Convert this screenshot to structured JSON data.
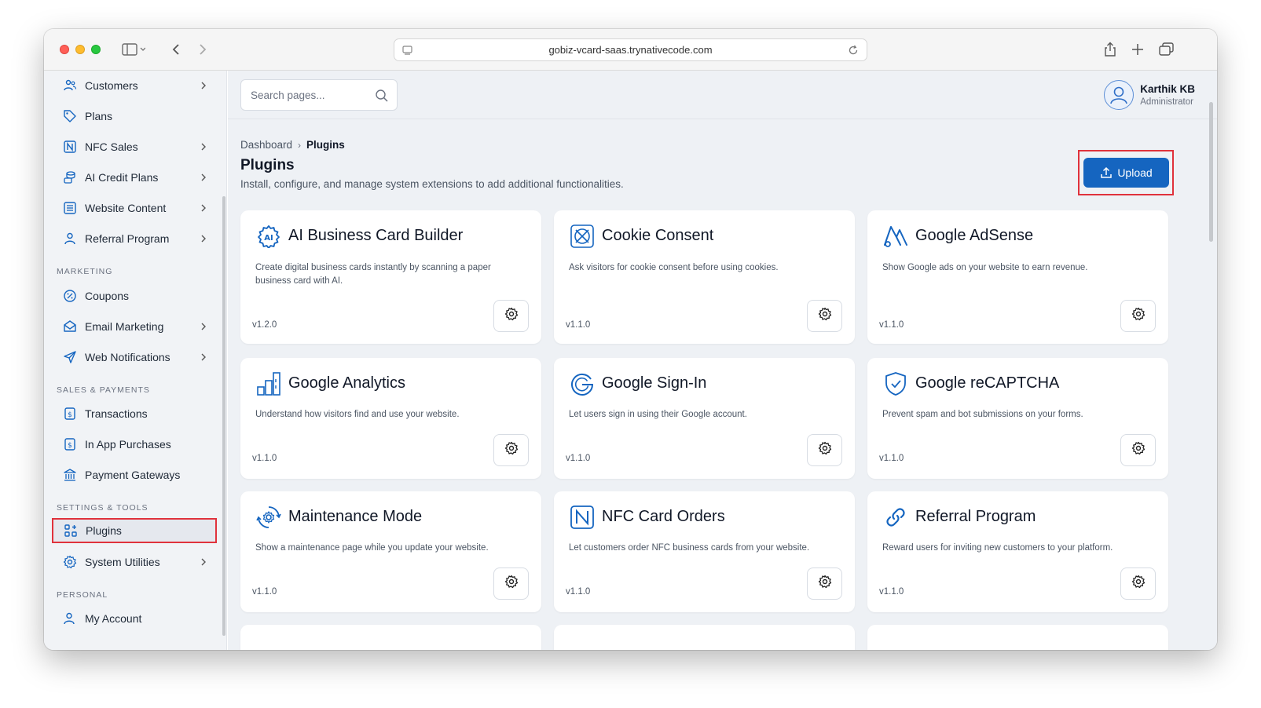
{
  "browser": {
    "url": "gobiz-vcard-saas.trynativecode.com"
  },
  "sidebar": {
    "items_top": [
      {
        "label": "Customers",
        "icon": "users-icon",
        "chevron": true
      },
      {
        "label": "Plans",
        "icon": "tag-icon",
        "chevron": false
      },
      {
        "label": "NFC Sales",
        "icon": "nfc-icon",
        "chevron": true
      },
      {
        "label": "AI Credit Plans",
        "icon": "coins-icon",
        "chevron": true
      },
      {
        "label": "Website Content",
        "icon": "document-icon",
        "chevron": true
      },
      {
        "label": "Referral Program",
        "icon": "user-icon",
        "chevron": true
      }
    ],
    "sections": {
      "marketing": "MARKETING",
      "sales": "SALES & PAYMENTS",
      "settings": "SETTINGS & TOOLS",
      "personal": "PERSONAL"
    },
    "marketing_items": [
      {
        "label": "Coupons",
        "icon": "percent-icon",
        "chevron": false
      },
      {
        "label": "Email Marketing",
        "icon": "mail-icon",
        "chevron": true
      },
      {
        "label": "Web Notifications",
        "icon": "send-icon",
        "chevron": true
      }
    ],
    "sales_items": [
      {
        "label": "Transactions",
        "icon": "receipt-icon",
        "chevron": false
      },
      {
        "label": "In App Purchases",
        "icon": "receipt-icon",
        "chevron": false
      },
      {
        "label": "Payment Gateways",
        "icon": "bank-icon",
        "chevron": false
      }
    ],
    "settings_items": [
      {
        "label": "Plugins",
        "icon": "apps-icon",
        "chevron": false,
        "active": true
      },
      {
        "label": "System Utilities",
        "icon": "gear-icon",
        "chevron": true
      }
    ],
    "personal_items": [
      {
        "label": "My Account",
        "icon": "account-icon",
        "chevron": false
      }
    ]
  },
  "header": {
    "search_placeholder": "Search pages...",
    "user_name": "Karthik KB",
    "user_role": "Administrator"
  },
  "page": {
    "breadcrumb_root": "Dashboard",
    "breadcrumb_sep": "›",
    "breadcrumb_current": "Plugins",
    "title": "Plugins",
    "description": "Install, configure, and manage system extensions to add additional functionalities.",
    "upload_label": "Upload"
  },
  "plugins": [
    {
      "title": "AI Business Card Builder",
      "desc": "Create digital business cards instantly by scanning a paper business card with AI.",
      "version": "v1.2.0",
      "icon": "ai-gear-icon"
    },
    {
      "title": "Cookie Consent",
      "desc": "Ask visitors for cookie consent before using cookies.",
      "version": "v1.1.0",
      "icon": "cookie-icon"
    },
    {
      "title": "Google AdSense",
      "desc": "Show Google ads on your website to earn revenue.",
      "version": "v1.1.0",
      "icon": "adsense-icon"
    },
    {
      "title": "Google Analytics",
      "desc": "Understand how visitors find and use your website.",
      "version": "v1.1.0",
      "icon": "analytics-icon"
    },
    {
      "title": "Google Sign-In",
      "desc": "Let users sign in using their Google account.",
      "version": "v1.1.0",
      "icon": "google-icon"
    },
    {
      "title": "Google reCAPTCHA",
      "desc": "Prevent spam and bot submissions on your forms.",
      "version": "v1.1.0",
      "icon": "shield-check-icon"
    },
    {
      "title": "Maintenance Mode",
      "desc": "Show a maintenance page while you update your website.",
      "version": "v1.1.0",
      "icon": "maintenance-icon"
    },
    {
      "title": "NFC Card Orders",
      "desc": "Let customers order NFC business cards from your website.",
      "version": "v1.1.0",
      "icon": "nfc-icon"
    },
    {
      "title": "Referral Program",
      "desc": "Reward users for inviting new customers to your platform.",
      "version": "v1.1.0",
      "icon": "link-icon"
    }
  ],
  "colors": {
    "accent": "#1565c0",
    "highlight_border": "#e0323c",
    "icon_blue": "#1565c0"
  }
}
